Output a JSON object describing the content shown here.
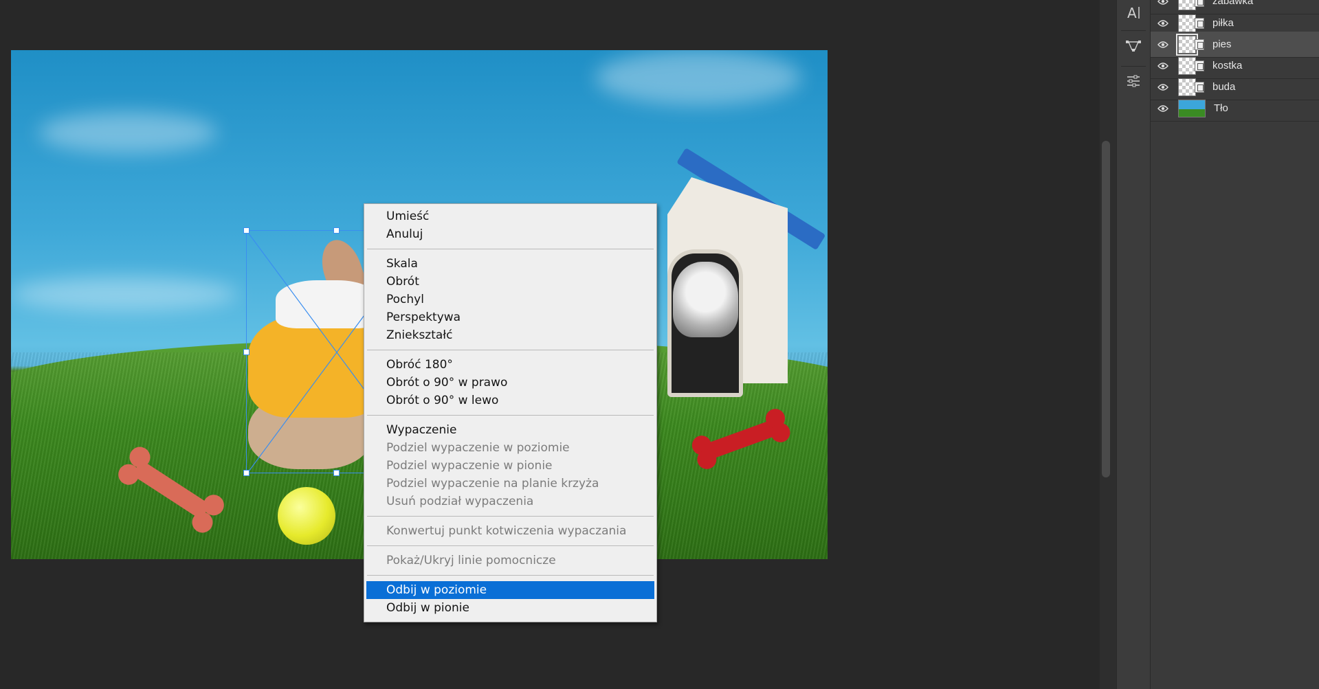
{
  "context_menu": {
    "items": [
      {
        "label": "Umieść",
        "enabled": true
      },
      {
        "label": "Anuluj",
        "enabled": true
      },
      {
        "separator": true
      },
      {
        "label": "Skala",
        "enabled": true
      },
      {
        "label": "Obrót",
        "enabled": true
      },
      {
        "label": "Pochyl",
        "enabled": true
      },
      {
        "label": "Perspektywa",
        "enabled": true
      },
      {
        "label": "Zniekształć",
        "enabled": true
      },
      {
        "separator": true
      },
      {
        "label": "Obróć 180°",
        "enabled": true
      },
      {
        "label": "Obrót o 90° w prawo",
        "enabled": true
      },
      {
        "label": "Obrót o 90° w lewo",
        "enabled": true
      },
      {
        "separator": true
      },
      {
        "label": "Wypaczenie",
        "enabled": true
      },
      {
        "label": "Podziel wypaczenie w poziomie",
        "enabled": false
      },
      {
        "label": "Podziel wypaczenie w pionie",
        "enabled": false
      },
      {
        "label": "Podziel wypaczenie na planie krzyża",
        "enabled": false
      },
      {
        "label": "Usuń podział wypaczenia",
        "enabled": false
      },
      {
        "separator": true
      },
      {
        "label": "Konwertuj punkt kotwiczenia wypaczania",
        "enabled": false
      },
      {
        "separator": true
      },
      {
        "label": "Pokaż/Ukryj linie pomocnicze",
        "enabled": false
      },
      {
        "separator": true
      },
      {
        "label": "Odbij w poziomie",
        "enabled": true,
        "selected": true
      },
      {
        "label": "Odbij w pionie",
        "enabled": true
      }
    ]
  },
  "layers": [
    {
      "name": "zabawka",
      "type": "smart-object"
    },
    {
      "name": "piłka",
      "type": "smart-object"
    },
    {
      "name": "pies",
      "type": "smart-object",
      "active": true
    },
    {
      "name": "kostka",
      "type": "smart-object"
    },
    {
      "name": "buda",
      "type": "smart-object"
    },
    {
      "name": "Tło",
      "type": "background"
    }
  ],
  "tools": [
    "character-icon",
    "paths-icon",
    "adjustments-icon"
  ],
  "colors": {
    "menu_highlight": "#0a6fd6",
    "transform_box": "#3a8ef0"
  }
}
